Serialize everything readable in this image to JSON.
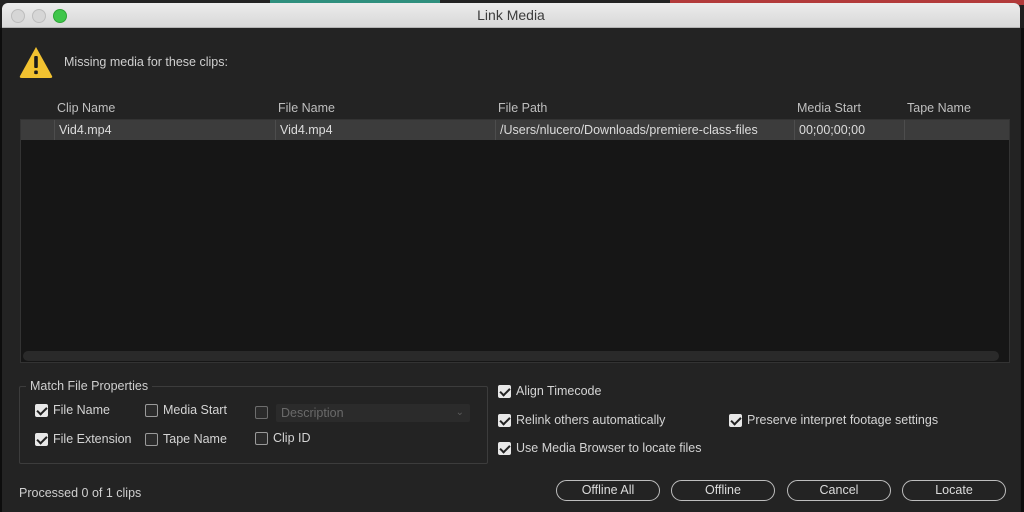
{
  "window": {
    "title": "Link Media"
  },
  "message": "Missing media for these clips:",
  "table": {
    "columns": [
      "Clip Name",
      "File Name",
      "File Path",
      "Media Start",
      "Tape Name"
    ],
    "rows": [
      {
        "clip_name": "Vid4.mp4",
        "file_name": "Vid4.mp4",
        "file_path": "/Users/nlucero/Downloads/premiere-class-files",
        "media_start": "00;00;00;00",
        "tape_name": ""
      }
    ]
  },
  "match_props": {
    "title": "Match File Properties",
    "file_name": {
      "label": "File Name",
      "checked": true
    },
    "file_extension": {
      "label": "File Extension",
      "checked": true
    },
    "media_start": {
      "label": "Media Start",
      "checked": false
    },
    "tape_name": {
      "label": "Tape Name",
      "checked": false
    },
    "description": {
      "label": "Description",
      "checked": false
    },
    "clip_id": {
      "label": "Clip ID",
      "checked": false
    }
  },
  "options": {
    "align_timecode": {
      "label": "Align Timecode",
      "checked": true
    },
    "relink_others": {
      "label": "Relink others automatically",
      "checked": true
    },
    "use_media_browser": {
      "label": "Use Media Browser to locate files",
      "checked": true
    },
    "preserve_interpret": {
      "label": "Preserve interpret footage settings",
      "checked": true
    }
  },
  "status": "Processed 0 of 1 clips",
  "buttons": {
    "offline_all": "Offline All",
    "offline": "Offline",
    "cancel": "Cancel",
    "locate": "Locate"
  },
  "icons": {
    "warning": "warning-icon",
    "dropdown": "chevron-down-icon"
  },
  "colors": {
    "warning": "#f2c230",
    "maximize": "#3fc64a"
  }
}
